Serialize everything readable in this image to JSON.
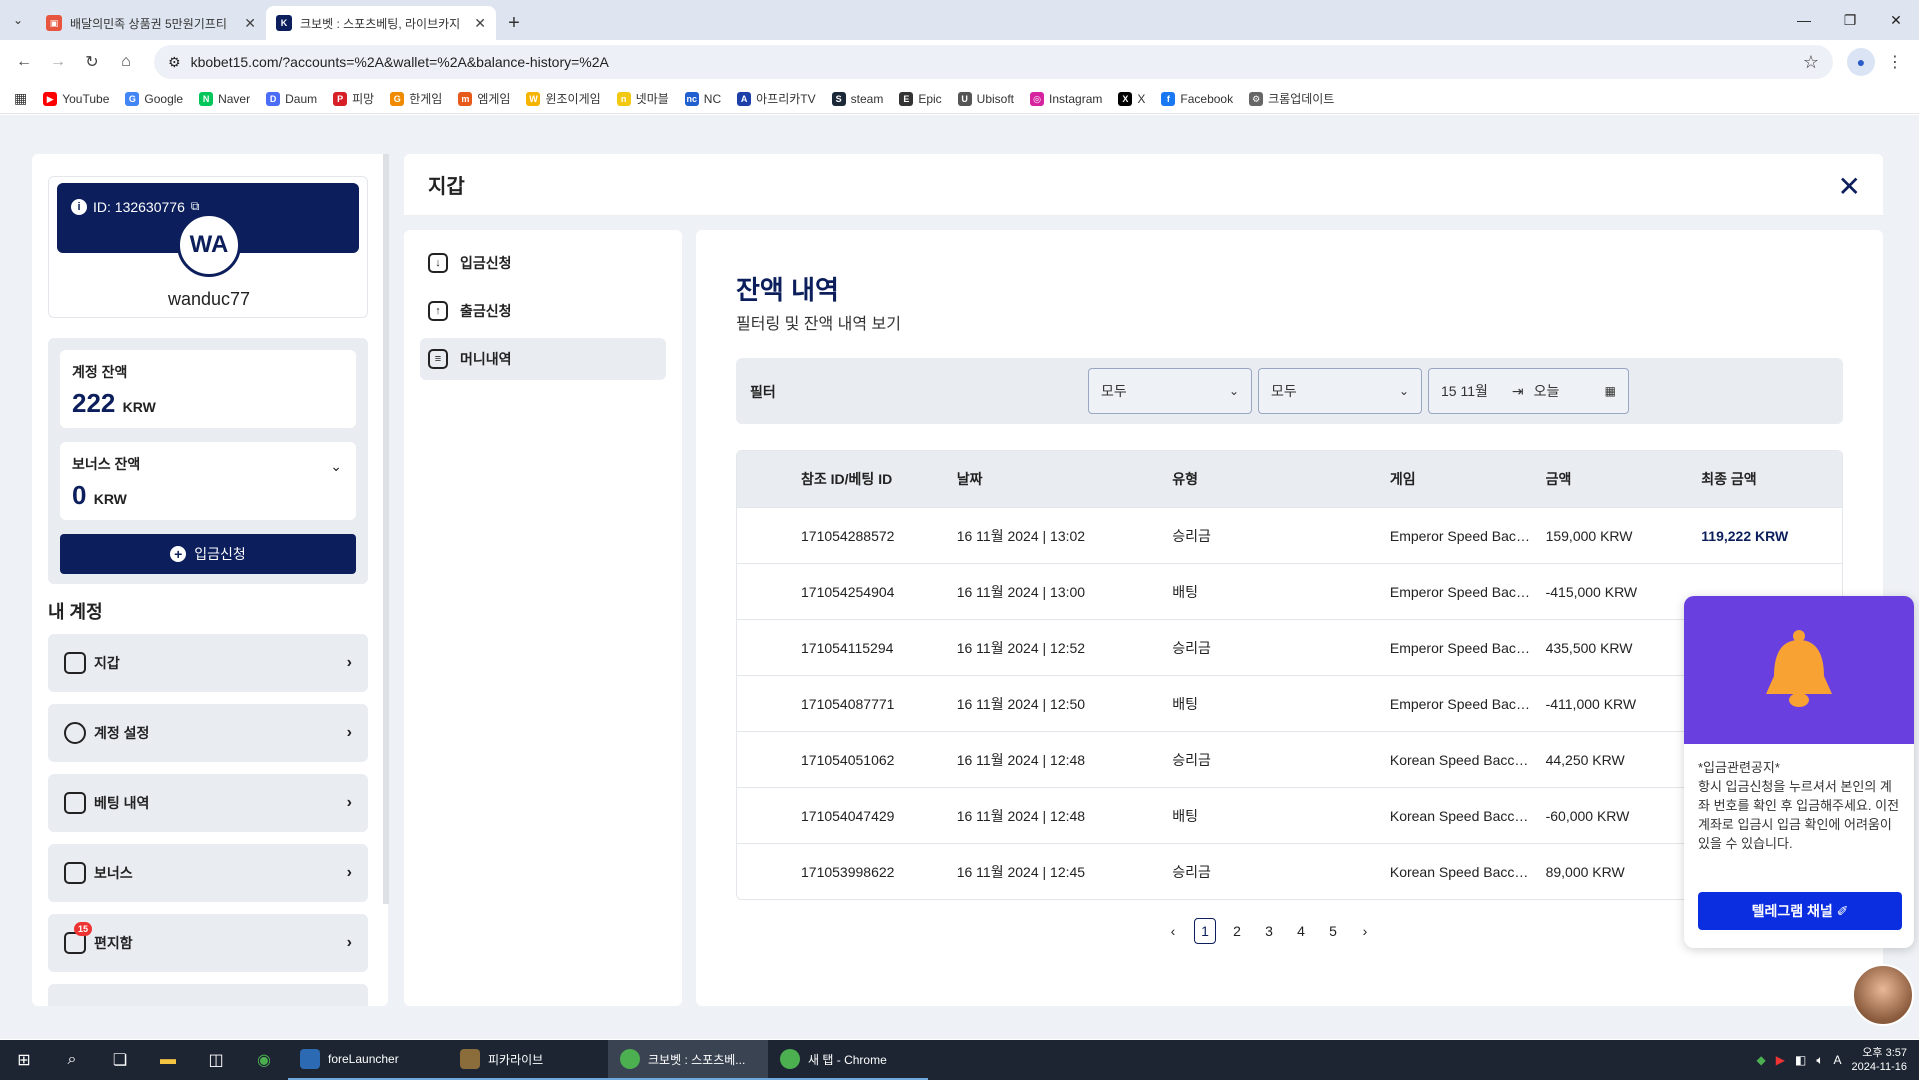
{
  "browser": {
    "tabs": [
      {
        "title": "배달의민족 상품권 5만원기프티",
        "active": false,
        "favicon_color": "#e8553e"
      },
      {
        "title": "크보벳 : 스포츠베팅, 라이브카지",
        "active": true,
        "favicon_color": "#0c1f5c"
      }
    ],
    "url": "kbobet15.com/?accounts=%2A&wallet=%2A&balance-history=%2A",
    "bookmarks": [
      {
        "label": "YouTube",
        "color": "#ff0000"
      },
      {
        "label": "Google",
        "color": "#4285f4"
      },
      {
        "label": "Naver",
        "color": "#03c75a"
      },
      {
        "label": "Daum",
        "color": "#4a6cf7"
      },
      {
        "label": "피망",
        "color": "#d61f26"
      },
      {
        "label": "한게임",
        "color": "#f08a00"
      },
      {
        "label": "엠게임",
        "color": "#e65b1c"
      },
      {
        "label": "윈조이게임",
        "color": "#f5b400"
      },
      {
        "label": "넷마블",
        "color": "#f2c811"
      },
      {
        "label": "NC",
        "color": "#1f5fd0"
      },
      {
        "label": "아프리카TV",
        "color": "#1c3faa"
      },
      {
        "label": "steam",
        "color": "#1b2838"
      },
      {
        "label": "Epic",
        "color": "#333333"
      },
      {
        "label": "Ubisoft",
        "color": "#555555"
      },
      {
        "label": "Instagram",
        "color": "#d6249f"
      },
      {
        "label": "X",
        "color": "#000000"
      },
      {
        "label": "Facebook",
        "color": "#1877f2"
      },
      {
        "label": "크롬업데이트",
        "color": "#666666"
      }
    ]
  },
  "profile": {
    "id_label": "ID: 132630776",
    "avatar_initials": "WA",
    "username": "wanduc77"
  },
  "balances": {
    "account_label": "계정 잔액",
    "account_value": "222",
    "account_currency": "KRW",
    "bonus_label": "보너스 잔액",
    "bonus_value": "0",
    "bonus_currency": "KRW",
    "deposit_button": "입금신청"
  },
  "my_account": {
    "title": "내 계정",
    "items": [
      {
        "label": "지갑"
      },
      {
        "label": "계정 설정"
      },
      {
        "label": "베팅 내역"
      },
      {
        "label": "보너스"
      },
      {
        "label": "편지함",
        "badge": "15"
      }
    ]
  },
  "wallet": {
    "title": "지갑",
    "menu": [
      {
        "label": "입금신청",
        "active": false
      },
      {
        "label": "출금신청",
        "active": false
      },
      {
        "label": "머니내역",
        "active": true
      }
    ],
    "heading": "잔액 내역",
    "subheading": "필터링 및 잔액 내역 보기",
    "filter": {
      "label": "필터",
      "select1": "모두",
      "select2": "모두",
      "date_from": "15 11월",
      "date_to": "오늘"
    },
    "table": {
      "headers": [
        "참조 ID/베팅 ID",
        "날짜",
        "유형",
        "게임",
        "금액",
        "최종 금액"
      ],
      "rows": [
        [
          "171054288572",
          "16 11월 2024 | 13:02",
          "승리금",
          "Emperor Speed Baccarat",
          "159,000 KRW",
          "119,222 KRW"
        ],
        [
          "171054254904",
          "16 11월 2024 | 13:00",
          "배팅",
          "Emperor Speed Baccarat",
          "-415,000 KRW",
          ""
        ],
        [
          "171054115294",
          "16 11월 2024 | 12:52",
          "승리금",
          "Emperor Speed Baccarat",
          "435,500 KRW",
          ""
        ],
        [
          "171054087771",
          "16 11월 2024 | 12:50",
          "배팅",
          "Emperor Speed Baccarat",
          "-411,000 KRW",
          ""
        ],
        [
          "171054051062",
          "16 11월 2024 | 12:48",
          "승리금",
          "Korean Speed Baccarat",
          "44,250 KRW",
          ""
        ],
        [
          "171054047429",
          "16 11월 2024 | 12:48",
          "배팅",
          "Korean Speed Baccarat",
          "-60,000 KRW",
          ""
        ],
        [
          "171053998622",
          "16 11월 2024 | 12:45",
          "승리금",
          "Korean Speed Baccarat",
          "89,000 KRW",
          ""
        ]
      ]
    },
    "pagination": {
      "pages": [
        "1",
        "2",
        "3",
        "4",
        "5"
      ],
      "current": "1"
    }
  },
  "popup": {
    "notice_title": "*입금관련공지*",
    "notice_body": "항시 입금신청을 누르셔서 본인의 계좌 번호를 확인 후 입금해주세요. 이전 계좌로 입금시 입금 확인에 어려움이 있을 수 있습니다.",
    "button": "텔레그램 채널 ✐"
  },
  "taskbar": {
    "apps": [
      {
        "label": "foreLauncher",
        "active": false
      },
      {
        "label": "피카라이브",
        "active": false
      },
      {
        "label": "크보벳 : 스포츠베...",
        "active": true
      },
      {
        "label": "새 탭 - Chrome",
        "active": false
      }
    ],
    "time": "오후 3:57",
    "date": "2024-11-16"
  }
}
